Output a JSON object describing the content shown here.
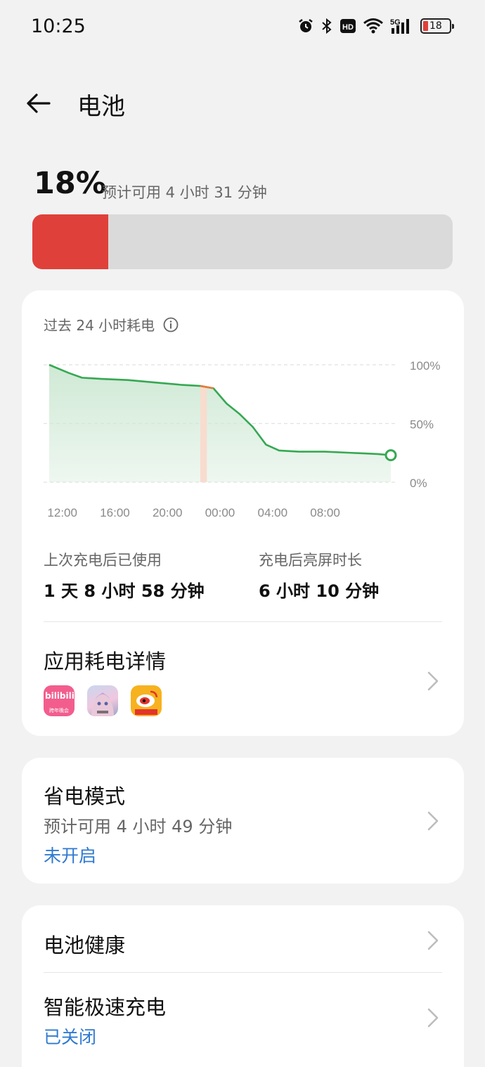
{
  "status_bar": {
    "time": "10:25",
    "network": "5G",
    "hd": "HD",
    "battery_level": "18",
    "icons": [
      "alarm-icon",
      "bluetooth-icon",
      "hd-icon",
      "wifi-icon",
      "signal-icon",
      "battery-icon"
    ]
  },
  "header": {
    "title": "电池",
    "back_icon": "arrow-left-icon"
  },
  "battery": {
    "percent_text": "18%",
    "level_fraction": 0.18,
    "estimate": "预计可用 4 小时 31 分钟",
    "bar_color": "#e0403a"
  },
  "usage_card": {
    "title": "过去 24 小时耗电",
    "since_charge_label": "上次充电后已使用",
    "since_charge_value": "1 天 8 小时 58 分钟",
    "screen_on_label": "充电后亮屏时长",
    "screen_on_value": "6 小时 10 分钟",
    "app_detail_title": "应用耗电详情",
    "apps": [
      "bilibili",
      "崩坏：星穹铁道",
      "微博"
    ],
    "bili_badge": "bilibili",
    "bili_sub": "跨年晚会"
  },
  "chart_data": {
    "type": "area",
    "x_tick_labels": [
      "12:00",
      "16:00",
      "20:00",
      "00:00",
      "04:00",
      "08:00"
    ],
    "y_tick_labels": [
      "100%",
      "50%",
      "0%"
    ],
    "ylim": [
      0,
      100
    ],
    "x_hours": [
      -1.0,
      0.5,
      1.5,
      3,
      5,
      7,
      9,
      10.5,
      11.5,
      12.5,
      13.5,
      14.5,
      15.5,
      16.5,
      18,
      20,
      22,
      24,
      25
    ],
    "battery_level": [
      100,
      93,
      89,
      88,
      87,
      85,
      83,
      82,
      80,
      67,
      58,
      47,
      32,
      27,
      26,
      26,
      25,
      24,
      23
    ],
    "drain_highlight_hours": [
      10.5,
      11.0
    ],
    "line_color": "#36a852",
    "fill_color": "#cfe9d5",
    "highlight_color": "#f8dccf",
    "highlight_line_color": "#e87a3a",
    "grid": "dashed"
  },
  "power_saving": {
    "title": "省电模式",
    "estimate": "预计可用 4 小时 49 分钟",
    "status": "未开启"
  },
  "battery_health": {
    "title": "电池健康"
  },
  "smart_charge": {
    "title": "智能极速充电",
    "status": "已关闭"
  },
  "accent_color": "#2f7ad0"
}
